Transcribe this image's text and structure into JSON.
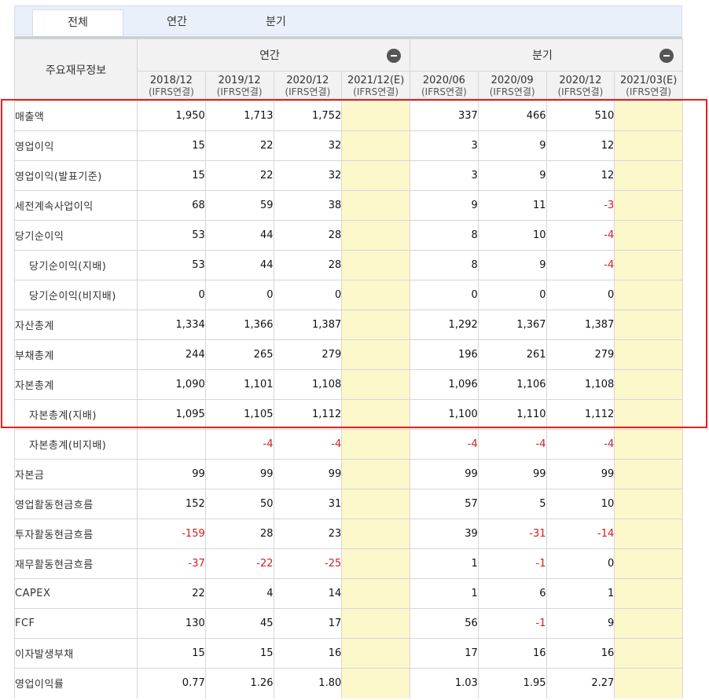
{
  "tabs": [
    "전체",
    "연간",
    "분기"
  ],
  "table": {
    "label_header": "주요재무정보",
    "group_annual": "연간",
    "group_quarter": "분기",
    "annual_cols": [
      {
        "period": "2018/12",
        "basis": "(IFRS연결)"
      },
      {
        "period": "2019/12",
        "basis": "(IFRS연결)"
      },
      {
        "period": "2020/12",
        "basis": "(IFRS연결)"
      },
      {
        "period": "2021/12(E)",
        "basis": "(IFRS연결)"
      }
    ],
    "quarter_cols": [
      {
        "period": "2020/06",
        "basis": "(IFRS연결)"
      },
      {
        "period": "2020/09",
        "basis": "(IFRS연결)"
      },
      {
        "period": "2020/12",
        "basis": "(IFRS연결)"
      },
      {
        "period": "2021/03(E)",
        "basis": "(IFRS연결)"
      }
    ],
    "rows": [
      {
        "label": "매출액",
        "indent": false,
        "annual": [
          "1,950",
          "1,713",
          "1,752",
          ""
        ],
        "quarter": [
          "337",
          "466",
          "510",
          ""
        ]
      },
      {
        "label": "영업이익",
        "indent": false,
        "annual": [
          "15",
          "22",
          "32",
          ""
        ],
        "quarter": [
          "3",
          "9",
          "12",
          ""
        ]
      },
      {
        "label": "영업이익(발표기준)",
        "indent": false,
        "annual": [
          "15",
          "22",
          "32",
          ""
        ],
        "quarter": [
          "3",
          "9",
          "12",
          ""
        ]
      },
      {
        "label": "세전계속사업이익",
        "indent": false,
        "annual": [
          "68",
          "59",
          "38",
          ""
        ],
        "quarter": [
          "9",
          "11",
          "-3",
          ""
        ]
      },
      {
        "label": "당기순이익",
        "indent": false,
        "annual": [
          "53",
          "44",
          "28",
          ""
        ],
        "quarter": [
          "8",
          "10",
          "-4",
          ""
        ]
      },
      {
        "label": "당기순이익(지배)",
        "indent": true,
        "annual": [
          "53",
          "44",
          "28",
          ""
        ],
        "quarter": [
          "8",
          "9",
          "-4",
          ""
        ]
      },
      {
        "label": "당기순이익(비지배)",
        "indent": true,
        "annual": [
          "0",
          "0",
          "0",
          ""
        ],
        "quarter": [
          "0",
          "0",
          "0",
          ""
        ]
      },
      {
        "label": "자산총계",
        "indent": false,
        "annual": [
          "1,334",
          "1,366",
          "1,387",
          ""
        ],
        "quarter": [
          "1,292",
          "1,367",
          "1,387",
          ""
        ]
      },
      {
        "label": "부채총계",
        "indent": false,
        "annual": [
          "244",
          "265",
          "279",
          ""
        ],
        "quarter": [
          "196",
          "261",
          "279",
          ""
        ]
      },
      {
        "label": "자본총계",
        "indent": false,
        "annual": [
          "1,090",
          "1,101",
          "1,108",
          ""
        ],
        "quarter": [
          "1,096",
          "1,106",
          "1,108",
          ""
        ]
      },
      {
        "label": "자본총계(지배)",
        "indent": true,
        "annual": [
          "1,095",
          "1,105",
          "1,112",
          ""
        ],
        "quarter": [
          "1,100",
          "1,110",
          "1,112",
          ""
        ]
      },
      {
        "label": "자본총계(비지배)",
        "indent": true,
        "annual": [
          "",
          "-4",
          "-4",
          ""
        ],
        "quarter": [
          "-4",
          "-4",
          "-4",
          ""
        ]
      },
      {
        "label": "자본금",
        "indent": false,
        "annual": [
          "99",
          "99",
          "99",
          ""
        ],
        "quarter": [
          "99",
          "99",
          "99",
          ""
        ]
      },
      {
        "label": "영업활동현금흐름",
        "indent": false,
        "annual": [
          "152",
          "50",
          "31",
          ""
        ],
        "quarter": [
          "57",
          "5",
          "10",
          ""
        ]
      },
      {
        "label": "투자활동현금흐름",
        "indent": false,
        "annual": [
          "-159",
          "28",
          "23",
          ""
        ],
        "quarter": [
          "39",
          "-31",
          "-14",
          ""
        ]
      },
      {
        "label": "재무활동현금흐름",
        "indent": false,
        "annual": [
          "-37",
          "-22",
          "-25",
          ""
        ],
        "quarter": [
          "1",
          "-1",
          "0",
          ""
        ]
      },
      {
        "label": "CAPEX",
        "indent": false,
        "annual": [
          "22",
          "4",
          "14",
          ""
        ],
        "quarter": [
          "1",
          "6",
          "1",
          ""
        ]
      },
      {
        "label": "FCF",
        "indent": false,
        "annual": [
          "130",
          "45",
          "17",
          ""
        ],
        "quarter": [
          "56",
          "-1",
          "9",
          ""
        ]
      },
      {
        "label": "이자발생부채",
        "indent": false,
        "annual": [
          "15",
          "15",
          "16",
          ""
        ],
        "quarter": [
          "17",
          "16",
          "16",
          ""
        ]
      },
      {
        "label": "영업이익률",
        "indent": false,
        "annual": [
          "0.77",
          "1.26",
          "1.80",
          ""
        ],
        "quarter": [
          "1.03",
          "1.95",
          "2.27",
          ""
        ]
      }
    ]
  },
  "colors": {
    "estimate_bg": "#fdf7cc",
    "negative": "#d01e1e",
    "highlight_border": "#ef1c1c",
    "tab_bar_bg": "#eaf0fa"
  },
  "icons": {
    "collapse": "minus-circle-icon"
  }
}
